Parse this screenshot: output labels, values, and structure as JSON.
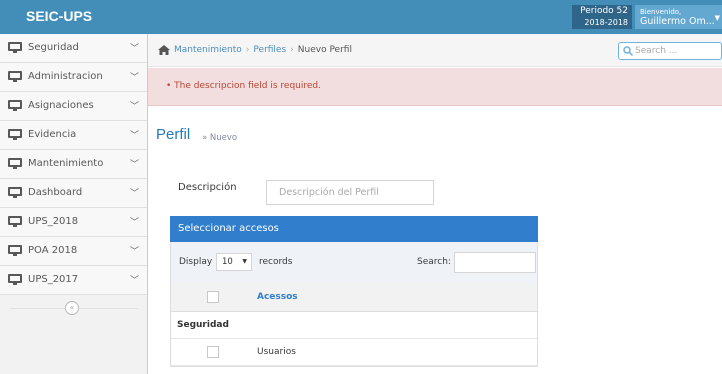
{
  "navbar": {
    "brand": "SEIC-UPS",
    "period_label": "Periodo 52",
    "period_years": "2018-2018",
    "greeting": "Bienvenido,",
    "user_name": "Guillermo Om..."
  },
  "sidebar": {
    "items": [
      {
        "label": "Seguridad",
        "icon": "desktop-icon"
      },
      {
        "label": "Administracion",
        "icon": "desktop-icon"
      },
      {
        "label": "Asignaciones",
        "icon": "desktop-icon"
      },
      {
        "label": "Evidencia",
        "icon": "desktop-icon"
      },
      {
        "label": "Mantenimiento",
        "icon": "desktop-icon"
      },
      {
        "label": "Dashboard",
        "icon": "desktop-icon"
      },
      {
        "label": "UPS_2018",
        "icon": "desktop-icon"
      },
      {
        "label": "POA 2018",
        "icon": "desktop-icon"
      },
      {
        "label": "UPS_2017",
        "icon": "desktop-icon"
      }
    ]
  },
  "breadcrumbs": [
    "Mantenimiento",
    "Perfiles",
    "Nuevo Perfil"
  ],
  "search": {
    "placeholder": "Search ..."
  },
  "alert": {
    "message": "The descripcion field is required."
  },
  "page": {
    "title": "Perfil",
    "subtitle": "» Nuevo"
  },
  "form": {
    "label": "Descripción",
    "placeholder": "Descripción del Perfil"
  },
  "panel": {
    "title": "Seleccionar accesos",
    "display_label": "Display",
    "page_size": "10",
    "records_label": "records",
    "search_label": "Search:",
    "column_header": "Acessos",
    "group": "Seguridad",
    "rows": [
      "Usuarios"
    ]
  },
  "colors": {
    "navbar": "#438eb9",
    "panel_header": "#307ecc",
    "alert_bg": "#f2dede",
    "alert_text": "#b74635",
    "title": "#2679b5"
  }
}
